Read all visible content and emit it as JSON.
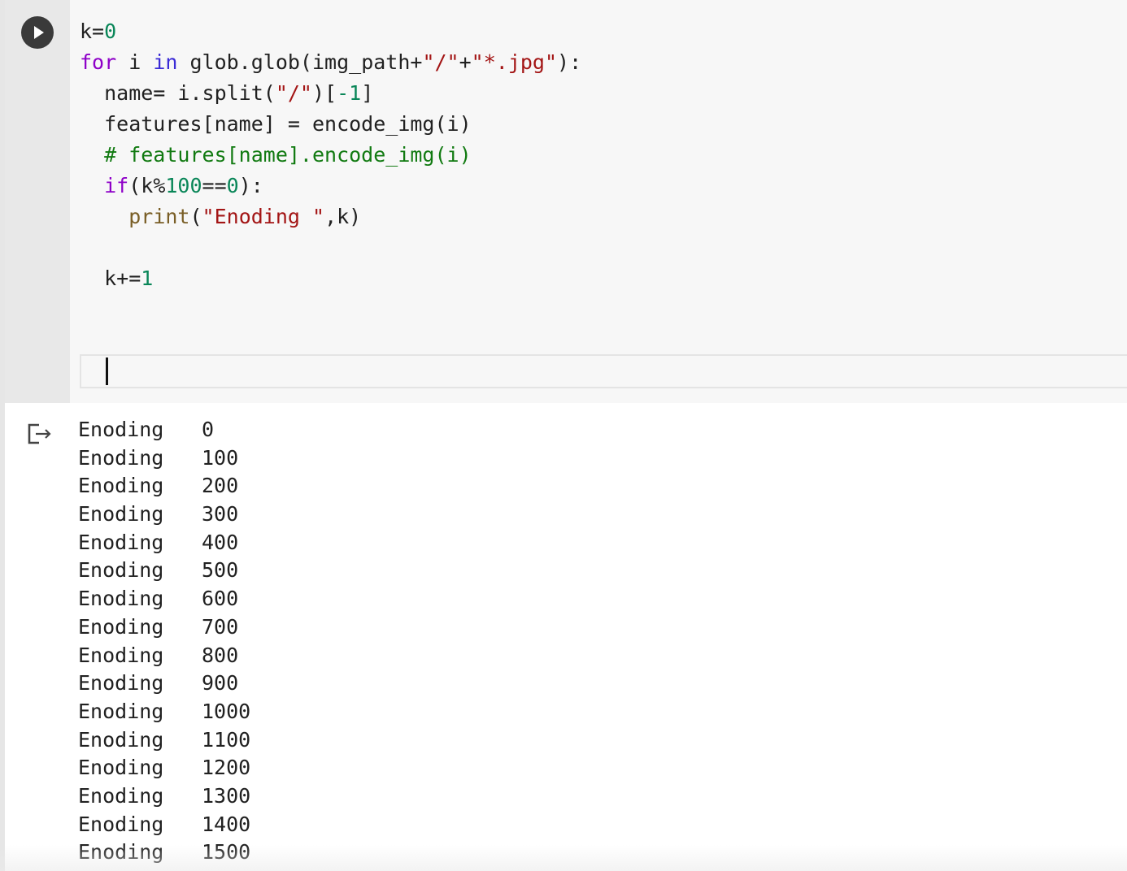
{
  "cell": {
    "code": {
      "l1": {
        "a": "k=",
        "b": "0"
      },
      "l2": {
        "a": "for",
        "b": " i ",
        "c": "in",
        "d": " glob.glob(img_path+",
        "e": "\"/\"",
        "f": "+",
        "g": "\"*.jpg\"",
        "h": "):"
      },
      "l3": {
        "a": "  name= i.split(",
        "b": "\"/\"",
        "c": ")[",
        "d": "-1",
        "e": "]"
      },
      "l4": {
        "a": "  features[name] = encode_img(i)"
      },
      "l5": {
        "a": "  # features[name].encode_img(i)"
      },
      "l6": {
        "a": "  ",
        "b": "if",
        "c": "(k%",
        "d": "100",
        "e": "==",
        "f": "0",
        "g": "):"
      },
      "l7": {
        "a": "    ",
        "b": "print",
        "c": "(",
        "d": "\"Enoding \"",
        "e": ",k)"
      },
      "l9": {
        "a": "  k+=",
        "b": "1"
      }
    }
  },
  "output": {
    "rows": [
      {
        "label": "Enoding",
        "value": "0"
      },
      {
        "label": "Enoding",
        "value": "100"
      },
      {
        "label": "Enoding",
        "value": "200"
      },
      {
        "label": "Enoding",
        "value": "300"
      },
      {
        "label": "Enoding",
        "value": "400"
      },
      {
        "label": "Enoding",
        "value": "500"
      },
      {
        "label": "Enoding",
        "value": "600"
      },
      {
        "label": "Enoding",
        "value": "700"
      },
      {
        "label": "Enoding",
        "value": "800"
      },
      {
        "label": "Enoding",
        "value": "900"
      },
      {
        "label": "Enoding",
        "value": "1000"
      },
      {
        "label": "Enoding",
        "value": "1100"
      },
      {
        "label": "Enoding",
        "value": "1200"
      },
      {
        "label": "Enoding",
        "value": "1300"
      },
      {
        "label": "Enoding",
        "value": "1400"
      },
      {
        "label": "Enoding",
        "value": "1500"
      }
    ]
  },
  "icons": {
    "run": "play-icon",
    "output": "output-redirect-icon"
  },
  "colors": {
    "keyword": "#8e00c8",
    "builtin": "#3b2bd6",
    "number": "#098658",
    "string": "#a31515",
    "comment": "#117a11",
    "function": "#795e26"
  }
}
